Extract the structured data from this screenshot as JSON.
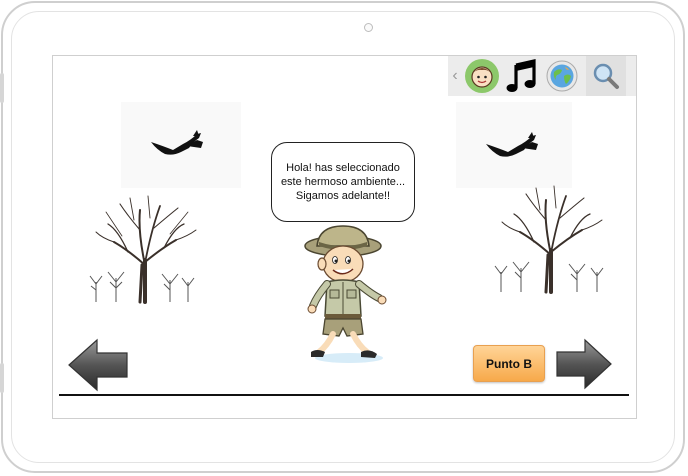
{
  "toolbar": {
    "items": [
      {
        "name": "chevron-left-icon",
        "glyph": "‹"
      },
      {
        "name": "character-face-icon"
      },
      {
        "name": "music-note-icon"
      },
      {
        "name": "world-map-icon"
      },
      {
        "name": "magnifier-icon"
      }
    ]
  },
  "speech_bubble": {
    "line1": "Hola! has seleccionado",
    "line2": "este hermoso ambiente...",
    "line3": "Sigamos adelante!!"
  },
  "buttons": {
    "point_b_label": "Punto B"
  },
  "colors": {
    "accent": "#f7a94a",
    "toolbar_bg": "#ececec",
    "face_bg": "#8cc86a"
  }
}
